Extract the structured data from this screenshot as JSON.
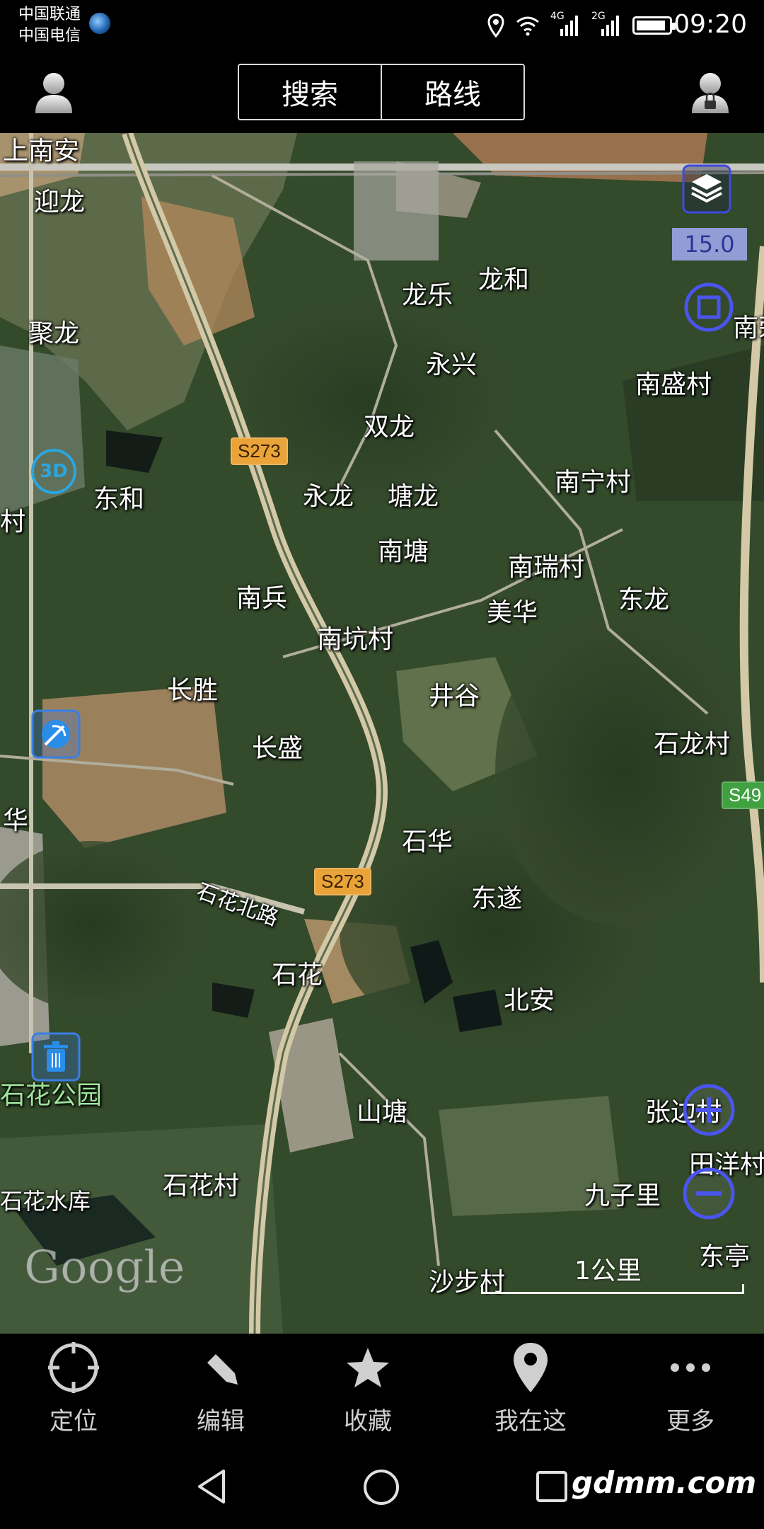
{
  "status_bar": {
    "carrier_1": "中国联通",
    "carrier_2": "中国电信",
    "net_1": "4G",
    "net_2": "2G",
    "time": "09:20",
    "battery_level": 0.9
  },
  "top_bar": {
    "tab_search": "搜索",
    "tab_route": "路线"
  },
  "map": {
    "zoom_level": "15.0",
    "btn_3d": "3D",
    "google_logo": "Google",
    "scale_label": "1公里",
    "place_labels": [
      {
        "text": "上南安",
        "kind": "place"
      },
      {
        "text": "迎龙",
        "kind": "place"
      },
      {
        "text": "聚龙",
        "kind": "place"
      },
      {
        "text": "龙乐",
        "kind": "place"
      },
      {
        "text": "龙和",
        "kind": "place"
      },
      {
        "text": "永兴",
        "kind": "place"
      },
      {
        "text": "南盛村",
        "kind": "place"
      },
      {
        "text": "双龙",
        "kind": "place"
      },
      {
        "text": "东和",
        "kind": "place"
      },
      {
        "text": "永龙",
        "kind": "place"
      },
      {
        "text": "塘龙",
        "kind": "place"
      },
      {
        "text": "南宁村",
        "kind": "place"
      },
      {
        "text": "南塘",
        "kind": "place"
      },
      {
        "text": "南瑞村",
        "kind": "place"
      },
      {
        "text": "南兵",
        "kind": "place"
      },
      {
        "text": "美华",
        "kind": "place"
      },
      {
        "text": "东龙",
        "kind": "place"
      },
      {
        "text": "南坑村",
        "kind": "place"
      },
      {
        "text": "长胜",
        "kind": "place"
      },
      {
        "text": "井谷",
        "kind": "place"
      },
      {
        "text": "长盛",
        "kind": "place"
      },
      {
        "text": "石龙村",
        "kind": "place"
      },
      {
        "text": "石华",
        "kind": "place"
      },
      {
        "text": "石花北路",
        "kind": "road"
      },
      {
        "text": "东遂",
        "kind": "place"
      },
      {
        "text": "石花",
        "kind": "place"
      },
      {
        "text": "北安",
        "kind": "place"
      },
      {
        "text": "石花公园",
        "kind": "park"
      },
      {
        "text": "山塘",
        "kind": "place"
      },
      {
        "text": "张边村",
        "kind": "place"
      },
      {
        "text": "石花村",
        "kind": "place"
      },
      {
        "text": "九子里",
        "kind": "place"
      },
      {
        "text": "田洋村",
        "kind": "place"
      },
      {
        "text": "石花水库",
        "kind": "place"
      },
      {
        "text": "沙步村",
        "kind": "place"
      },
      {
        "text": "东亭",
        "kind": "place"
      },
      {
        "text": "南荣",
        "kind": "place"
      },
      {
        "text": "村",
        "kind": "place"
      },
      {
        "text": "华",
        "kind": "place"
      }
    ],
    "road_shields": [
      {
        "text": "S273",
        "color": "#e9a338"
      },
      {
        "text": "S273",
        "color": "#e9a338"
      },
      {
        "text": "S49",
        "color": "#3fa140"
      }
    ]
  },
  "bottom_nav": [
    {
      "label": "定位",
      "icon": "crosshair-icon"
    },
    {
      "label": "编辑",
      "icon": "pencil-icon"
    },
    {
      "label": "收藏",
      "icon": "star-icon"
    },
    {
      "label": "我在这",
      "icon": "map-pin-icon"
    },
    {
      "label": "更多",
      "icon": "more-dots-icon"
    }
  ],
  "watermark": "gdmm.com",
  "colors": {
    "accent_blue": "#3f49e0",
    "shield_orange": "#e9a338",
    "shield_green": "#3fa140"
  }
}
